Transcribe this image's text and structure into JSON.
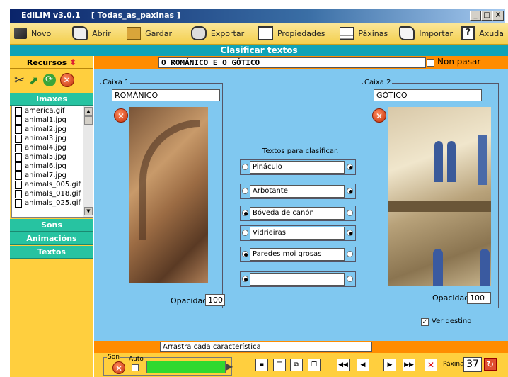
{
  "window": {
    "title": "EdiLIM v3.0.1",
    "document": "[ Todas_as_paxinas ]",
    "buttons": [
      "_",
      "□",
      "X"
    ]
  },
  "toolbar": [
    {
      "label": "Novo",
      "icon": "book-icon"
    },
    {
      "label": "Abrir",
      "icon": "open-icon"
    },
    {
      "label": "Gardar",
      "icon": "save-box-icon"
    },
    {
      "label": "Exportar",
      "icon": "export-icon"
    },
    {
      "label": "Propiedades",
      "icon": "properties-icon"
    },
    {
      "label": "Páxinas",
      "icon": "pages-icon"
    },
    {
      "label": "Importar",
      "icon": "import-icon"
    },
    {
      "label": "Axuda",
      "icon": "help-icon"
    }
  ],
  "subtitle": "Clasificar textos",
  "sidebar": {
    "header": "Recursos",
    "sections": {
      "images": "Imaxes",
      "sounds": "Sons",
      "animations": "Animacións",
      "texts": "Textos"
    },
    "files": [
      "america.gif",
      "animal1.jpg",
      "animal2.jpg",
      "animal3.jpg",
      "animal4.jpg",
      "animal5.jpg",
      "animal6.jpg",
      "animal7.jpg",
      "animals_005.gif",
      "animals_018.gif",
      "animals_025.gif"
    ]
  },
  "page": {
    "title_field": "O ROMÁNICO E O GÓTICO",
    "non_pasar": "Non pasar",
    "box1": {
      "label": "Caixa 1",
      "name": "ROMÁNICO",
      "opacity_label": "Opacidade",
      "opacity": "100"
    },
    "box2": {
      "label": "Caixa 2",
      "name": "GÓTICO",
      "opacity_label": "Opacidade",
      "opacity": "100"
    },
    "items_heading": "Textos para clasificar.",
    "items": [
      {
        "text": "Pináculo",
        "side": "right"
      },
      {
        "text": "Arbotante",
        "side": "right"
      },
      {
        "text": "Bóveda de canón",
        "side": "left"
      },
      {
        "text": "Vidrieiras",
        "side": "right"
      },
      {
        "text": "Paredes moi grosas",
        "side": "left"
      },
      {
        "text": "",
        "side": "left"
      }
    ],
    "ver_destino": "Ver destino",
    "instruction": "Arrastra cada característica"
  },
  "footer": {
    "son": "Son",
    "auto": "Auto",
    "paxina_label": "Páxina",
    "paxina": "37"
  }
}
